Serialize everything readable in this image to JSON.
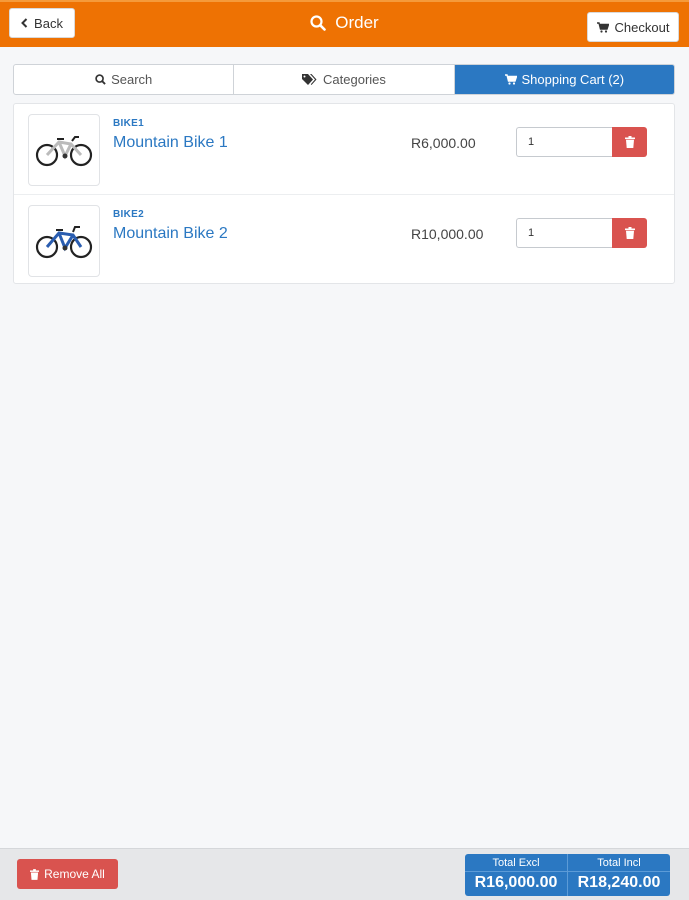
{
  "header": {
    "back_label": "Back",
    "title": "Order",
    "checkout_label": "Checkout",
    "background_color": "#ee7203"
  },
  "tabs": [
    {
      "label": "Search",
      "icon": "search-icon",
      "active": false
    },
    {
      "label": "Categories",
      "icon": "tags-icon",
      "active": false
    },
    {
      "label": "Shopping Cart (2)",
      "icon": "cart-icon",
      "active": true
    }
  ],
  "cart": {
    "items": [
      {
        "sku": "BIKE1",
        "name": "Mountain Bike 1",
        "price": "R6,000.00",
        "quantity": "1",
        "image": "mountain-bike-white-icon"
      },
      {
        "sku": "BIKE2",
        "name": "Mountain Bike 2",
        "price": "R10,000.00",
        "quantity": "1",
        "image": "mountain-bike-blue-icon"
      }
    ]
  },
  "footer": {
    "remove_all_label": "Remove All",
    "total_excl_label": "Total Excl",
    "total_excl_value": "R16,000.00",
    "total_incl_label": "Total Incl",
    "total_incl_value": "R18,240.00"
  },
  "colors": {
    "accent": "#2b78c2",
    "danger": "#d9534f"
  }
}
